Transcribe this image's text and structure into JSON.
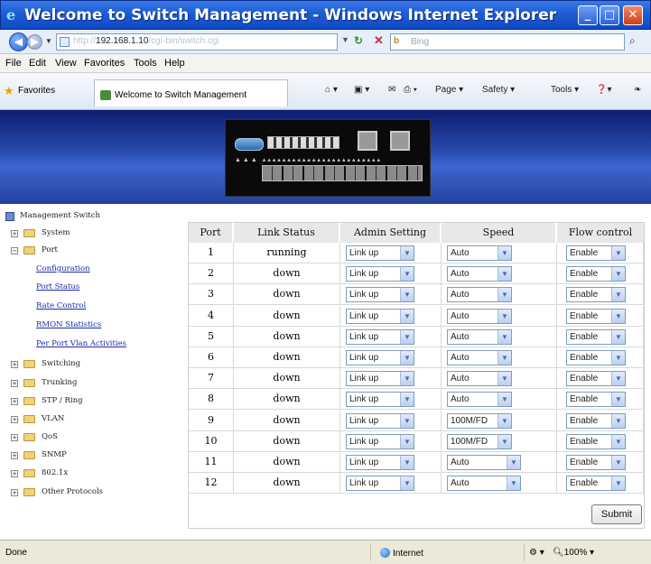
{
  "window": {
    "title": "Welcome to Switch Management - Windows Internet Explorer",
    "min_glyph": "_",
    "max_glyph": "□",
    "close_glyph": "✕"
  },
  "addressbar": {
    "url_prefix": "http://",
    "url_host": "192.168.1.10",
    "url_rest": "/cgi-bin/switch.cgi",
    "search_placeholder": "Bing"
  },
  "menu": [
    "File",
    "Edit",
    "View",
    "Favorites",
    "Tools",
    "Help"
  ],
  "favbar": {
    "favorites_label": "Favorites",
    "tab_title": "Welcome to Switch Management",
    "commands": [
      "Page ▾",
      "Safety ▾",
      "Tools ▾"
    ]
  },
  "tree": {
    "root": "Management Switch",
    "items": [
      {
        "label": "System",
        "type": "folder",
        "expanded": false
      },
      {
        "label": "Port",
        "type": "folder",
        "expanded": true
      },
      {
        "label": "Configuration",
        "type": "link"
      },
      {
        "label": "Port Status",
        "type": "link"
      },
      {
        "label": "Rate Control",
        "type": "link"
      },
      {
        "label": "RMON Statistics",
        "type": "link"
      },
      {
        "label": "Per Port Vlan Activities",
        "type": "link"
      },
      {
        "label": "Switching",
        "type": "folder",
        "expanded": false
      },
      {
        "label": "Trunking",
        "type": "folder",
        "expanded": false
      },
      {
        "label": "STP / Ring",
        "type": "folder",
        "expanded": false
      },
      {
        "label": "VLAN",
        "type": "folder",
        "expanded": false
      },
      {
        "label": "QoS",
        "type": "folder",
        "expanded": false
      },
      {
        "label": "SNMP",
        "type": "folder",
        "expanded": false
      },
      {
        "label": "802.1x",
        "type": "folder",
        "expanded": false
      },
      {
        "label": "Other Protocols",
        "type": "folder",
        "expanded": false
      }
    ]
  },
  "table": {
    "headers": [
      "Port",
      "Link Status",
      "Admin Setting",
      "Speed",
      "Flow control"
    ],
    "rows": [
      {
        "port": "1",
        "link": "running",
        "admin": "Link up",
        "speed": "Auto",
        "flow": "Enable"
      },
      {
        "port": "2",
        "link": "down",
        "admin": "Link up",
        "speed": "Auto",
        "flow": "Enable"
      },
      {
        "port": "3",
        "link": "down",
        "admin": "Link up",
        "speed": "Auto",
        "flow": "Enable"
      },
      {
        "port": "4",
        "link": "down",
        "admin": "Link up",
        "speed": "Auto",
        "flow": "Enable"
      },
      {
        "port": "5",
        "link": "down",
        "admin": "Link up",
        "speed": "Auto",
        "flow": "Enable"
      },
      {
        "port": "6",
        "link": "down",
        "admin": "Link up",
        "speed": "Auto",
        "flow": "Enable"
      },
      {
        "port": "7",
        "link": "down",
        "admin": "Link up",
        "speed": "Auto",
        "flow": "Enable"
      },
      {
        "port": "8",
        "link": "down",
        "admin": "Link up",
        "speed": "Auto",
        "flow": "Enable"
      },
      {
        "port": "9",
        "link": "down",
        "admin": "Link up",
        "speed": "100M/FD",
        "flow": "Enable"
      },
      {
        "port": "10",
        "link": "down",
        "admin": "Link up",
        "speed": "100M/FD",
        "flow": "Enable"
      },
      {
        "port": "11",
        "link": "down",
        "admin": "Link up",
        "speed": "Auto",
        "flow": "Enable"
      },
      {
        "port": "12",
        "link": "down",
        "admin": "Link up",
        "speed": "Auto",
        "flow": "Enable"
      }
    ],
    "submit_label": "Submit"
  },
  "status": {
    "text": "Done",
    "zone": "Internet",
    "zoom": "100%"
  },
  "colors": {
    "titlebar": "#1f5fd6",
    "banner": "#2a4bb0",
    "link": "#1a2ca8"
  }
}
